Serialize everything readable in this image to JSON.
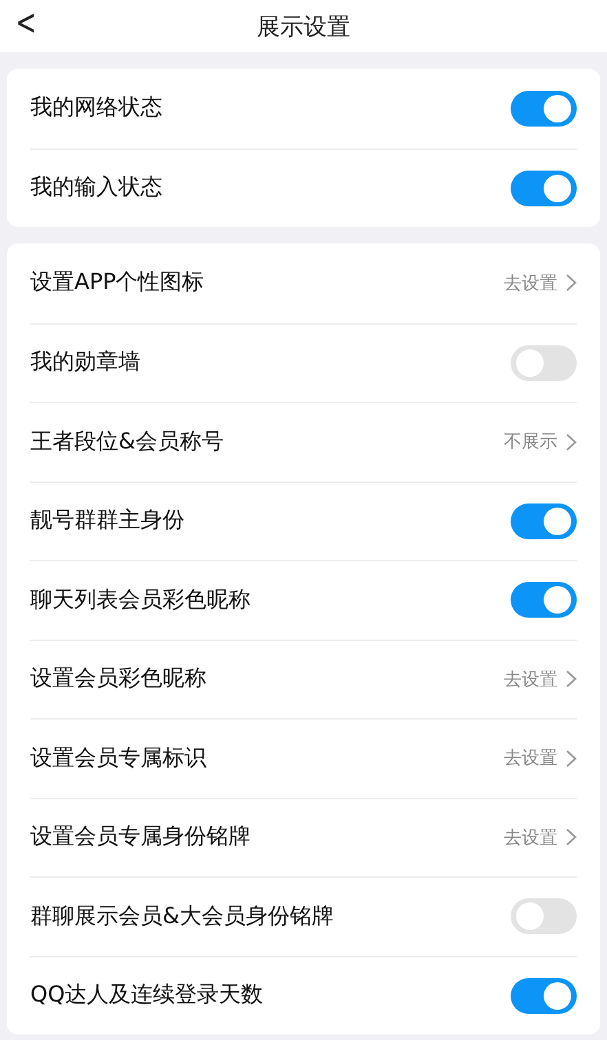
{
  "header": {
    "back": "<",
    "title": "展示设置"
  },
  "groups": [
    {
      "rows": [
        {
          "kind": "toggle",
          "label": "我的网络状态",
          "on": true
        },
        {
          "kind": "toggle",
          "label": "我的输入状态",
          "on": true
        }
      ]
    },
    {
      "rows": [
        {
          "kind": "link",
          "label": "设置APP个性图标",
          "value": "去设置"
        },
        {
          "kind": "toggle",
          "label": "我的勋章墙",
          "on": false
        },
        {
          "kind": "link",
          "label": "王者段位&会员称号",
          "value": "不展示"
        },
        {
          "kind": "toggle",
          "label": "靓号群群主身份",
          "on": true
        },
        {
          "kind": "toggle",
          "label": "聊天列表会员彩色昵称",
          "on": true
        },
        {
          "kind": "link",
          "label": "设置会员彩色昵称",
          "value": "去设置"
        },
        {
          "kind": "link",
          "label": "设置会员专属标识",
          "value": "去设置"
        },
        {
          "kind": "link",
          "label": "设置会员专属身份铭牌",
          "value": "去设置"
        },
        {
          "kind": "toggle",
          "label": "群聊展示会员&大会员身份铭牌",
          "on": false
        },
        {
          "kind": "toggle",
          "label": "QQ达人及连续登录天数",
          "on": true
        }
      ]
    }
  ]
}
